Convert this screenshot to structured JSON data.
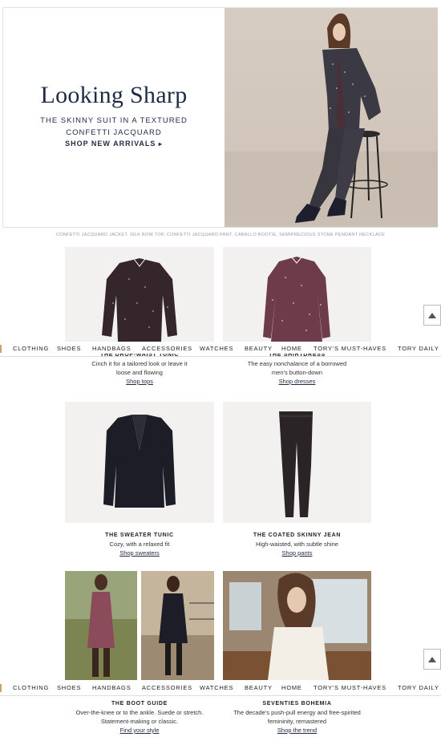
{
  "hero": {
    "title": "Looking Sharp",
    "subtitle": "THE SKINNY SUIT IN A TEXTURED CONFETTI JACQUARD",
    "cta": "SHOP NEW ARRIVALS",
    "cta_icon": "chevron-right-icon"
  },
  "caption": "CONFETTI JACQUARD JACKET, SILK BOW TOP, CONFETTI JACQUARD PANT, CABALLO BOOTIE, SEMIPRECIOUS STONE PENDANT NECKLACE",
  "nav": {
    "items": [
      "CLOTHING",
      "SHOES",
      "HANDBAGS",
      "ACCESSORIES",
      "WATCHES",
      "BEAUTY",
      "HOME",
      "TORY'S MUST-HAVES",
      "TORY DAILY"
    ]
  },
  "row1": [
    {
      "title": "THE DROP-WAIST TUNIC",
      "desc1": "Cinch it for a tailored look or leave it",
      "desc2": "loose and flowing",
      "link": "Shop tops"
    },
    {
      "title": "THE SHIRTDRESS",
      "desc1": "The easy nonchalance of a borrowed",
      "desc2": "men's button-down",
      "link": "Shop dresses"
    }
  ],
  "row2": [
    {
      "title": "THE SWEATER TUNIC",
      "desc1": "Cozy, with a relaxed fit",
      "link": "Shop sweaters"
    },
    {
      "title": "THE COATED SKINNY JEAN",
      "desc1": "High-waisted, with subtle shine",
      "link": "Shop pants"
    }
  ],
  "row3": [
    {
      "title": "THE BOOT GUIDE",
      "desc1": "Over-the-knee or to the ankle. Suede or stretch.",
      "desc2": "Statement-making or classic.",
      "link": "Find your style"
    },
    {
      "title": "SEVENTIES BOHEMIA",
      "desc1": "The decade's push-pull energy and free-spirited",
      "desc2": "femininity, remastered",
      "link": "Shop the trend"
    }
  ],
  "colors": {
    "navy": "#1f2a44",
    "accent": "#c9a36a"
  }
}
